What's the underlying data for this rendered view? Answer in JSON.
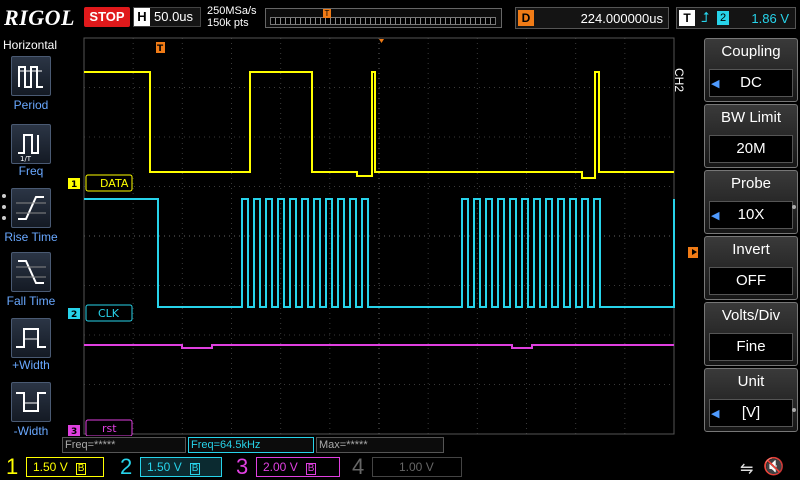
{
  "topbar": {
    "logo": "RIGOL",
    "run_state": "STOP",
    "horizontal": {
      "label": "H",
      "value": "50.0us"
    },
    "sample_rate": "250MSa/s",
    "memory_depth": "150k pts",
    "delay": {
      "label": "D",
      "value": "224.000000us"
    },
    "trigger": {
      "label": "T",
      "channel": "2",
      "level": "1.86 V"
    }
  },
  "left_menu": {
    "title": "Horizontal",
    "items": [
      {
        "label": "Period",
        "icon": "period-icon"
      },
      {
        "label": "Freq",
        "icon": "freq-icon"
      },
      {
        "label": "Rise Time",
        "icon": "rise-time-icon"
      },
      {
        "label": "Fall Time",
        "icon": "fall-time-icon"
      },
      {
        "label": "+Width",
        "icon": "positive-width-icon"
      },
      {
        "label": "-Width",
        "icon": "negative-width-icon"
      }
    ]
  },
  "channels_on_screen": {
    "ch1_label": "DATA",
    "ch2_label": "CLK",
    "ch3_label": "rst"
  },
  "measurements": [
    {
      "text": "Freq=*****"
    },
    {
      "text": "Freq=64.5kHz"
    },
    {
      "text": "Max=*****"
    }
  ],
  "bottom_bar": {
    "channels": [
      {
        "num": "1",
        "scale": "1.50 V",
        "color": "#ffff00"
      },
      {
        "num": "2",
        "scale": "1.50 V",
        "color": "#27d3ea"
      },
      {
        "num": "3",
        "scale": "2.00 V",
        "color": "#e040e0"
      },
      {
        "num": "4",
        "scale": "1.00 V",
        "color": "#555555"
      }
    ]
  },
  "right_menu": {
    "channel_tag": "CH2",
    "items": [
      {
        "title": "Coupling",
        "value": "DC"
      },
      {
        "title": "BW Limit",
        "value": "20M"
      },
      {
        "title": "Probe",
        "value": "10X"
      },
      {
        "title": "Invert",
        "value": "OFF"
      },
      {
        "title": "Volts/Div",
        "value": "Fine"
      },
      {
        "title": "Unit",
        "value": "[V]"
      }
    ]
  },
  "colors": {
    "ch1": "#ffff00",
    "ch2": "#27d3ea",
    "ch3": "#e040e0",
    "trigger_marker": "#f07b16",
    "stop": "#e0191b"
  }
}
